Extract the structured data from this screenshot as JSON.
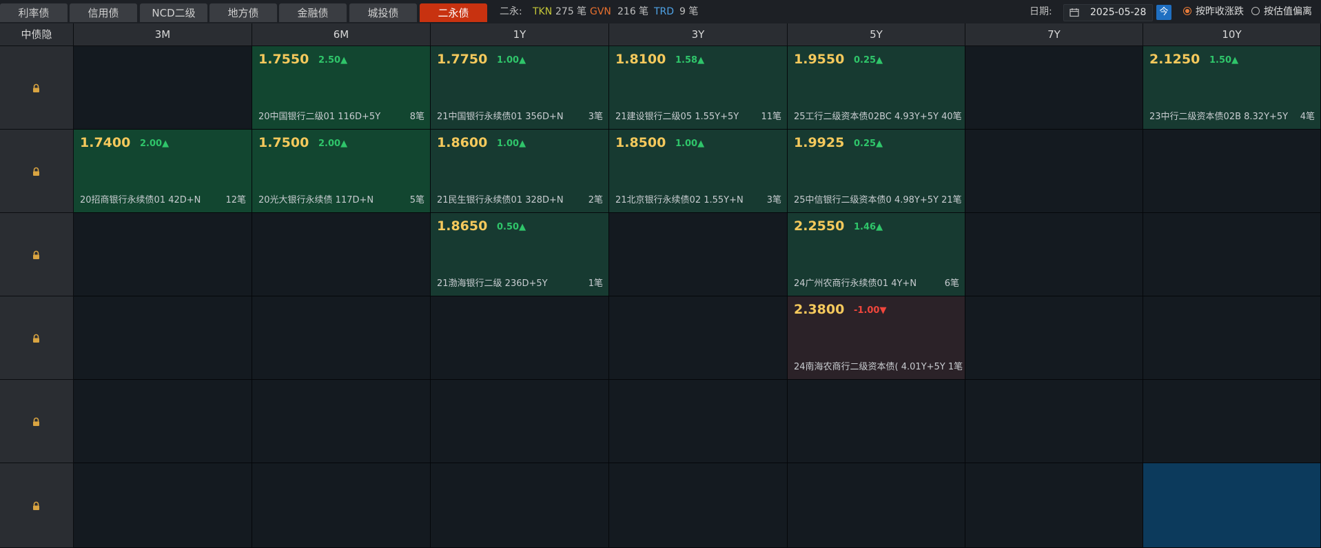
{
  "tabs": [
    {
      "label": "利率债",
      "active": false
    },
    {
      "label": "信用债",
      "active": false
    },
    {
      "label": "NCD二级",
      "active": false
    },
    {
      "label": "地方债",
      "active": false
    },
    {
      "label": "金融债",
      "active": false
    },
    {
      "label": "城投债",
      "active": false
    },
    {
      "label": "二永债",
      "active": true
    }
  ],
  "summary": {
    "prefix": "二永:",
    "tkn_label": "TKN",
    "tkn_value": "275 笔",
    "gvn_label": "GVN",
    "gvn_value": "216 笔",
    "trd_label": "TRD",
    "trd_value": "9 笔"
  },
  "date": {
    "label": "日期:",
    "value": "2025-05-28",
    "today": "今"
  },
  "sort_options": [
    {
      "label": "按昨收涨跌",
      "selected": true
    },
    {
      "label": "按估值偏离",
      "selected": false
    }
  ],
  "grid": {
    "corner_label": "中债隐",
    "columns": [
      "3M",
      "6M",
      "1Y",
      "3Y",
      "5Y",
      "7Y",
      "10Y"
    ],
    "row_count": 6,
    "cells": [
      {
        "row": 0,
        "col": 1,
        "yield": "1.7550",
        "change": "2.50▲",
        "dir": "up",
        "bond": "20中国银行二级01 116D+5Y",
        "count": "8笔",
        "tone": "green1"
      },
      {
        "row": 0,
        "col": 2,
        "yield": "1.7750",
        "change": "1.00▲",
        "dir": "up",
        "bond": "21中国银行永续债01 356D+N",
        "count": "3笔",
        "tone": "green2"
      },
      {
        "row": 0,
        "col": 3,
        "yield": "1.8100",
        "change": "1.58▲",
        "dir": "up",
        "bond": "21建设银行二级05 1.55Y+5Y",
        "count": "11笔",
        "tone": "green2"
      },
      {
        "row": 0,
        "col": 4,
        "yield": "1.9550",
        "change": "0.25▲",
        "dir": "up",
        "bond": "25工行二级资本债02BC 4.93Y+5Y 40笔",
        "count": "",
        "tone": "green2"
      },
      {
        "row": 0,
        "col": 6,
        "yield": "2.1250",
        "change": "1.50▲",
        "dir": "up",
        "bond": "23中行二级资本债02B 8.32Y+5Y",
        "count": "4笔",
        "tone": "green2"
      },
      {
        "row": 1,
        "col": 0,
        "yield": "1.7400",
        "change": "2.00▲",
        "dir": "up",
        "bond": "20招商银行永续债01 42D+N",
        "count": "12笔",
        "tone": "green1"
      },
      {
        "row": 1,
        "col": 1,
        "yield": "1.7500",
        "change": "2.00▲",
        "dir": "up",
        "bond": "20光大银行永续债 117D+N",
        "count": "5笔",
        "tone": "green1"
      },
      {
        "row": 1,
        "col": 2,
        "yield": "1.8600",
        "change": "1.00▲",
        "dir": "up",
        "bond": "21民生银行永续债01 328D+N",
        "count": "2笔",
        "tone": "green2"
      },
      {
        "row": 1,
        "col": 3,
        "yield": "1.8500",
        "change": "1.00▲",
        "dir": "up",
        "bond": "21北京银行永续债02 1.55Y+N",
        "count": "3笔",
        "tone": "green2"
      },
      {
        "row": 1,
        "col": 4,
        "yield": "1.9925",
        "change": "0.25▲",
        "dir": "up",
        "bond": "25中信银行二级资本债0 4.98Y+5Y 21笔",
        "count": "",
        "tone": "green2"
      },
      {
        "row": 2,
        "col": 2,
        "yield": "1.8650",
        "change": "0.50▲",
        "dir": "up",
        "bond": "21渤海银行二级 236D+5Y",
        "count": "1笔",
        "tone": "green2"
      },
      {
        "row": 2,
        "col": 4,
        "yield": "2.2550",
        "change": "1.46▲",
        "dir": "up",
        "bond": "24广州农商行永续债01 4Y+N",
        "count": "6笔",
        "tone": "green2"
      },
      {
        "row": 3,
        "col": 4,
        "yield": "2.3800",
        "change": "-1.00▼",
        "dir": "down",
        "bond": "24南海农商行二级资本债( 4.01Y+5Y 1笔",
        "count": "",
        "tone": "red"
      },
      {
        "row": 5,
        "col": 6,
        "yield": "",
        "change": "",
        "dir": "",
        "bond": "",
        "count": "",
        "tone": "blue"
      }
    ]
  },
  "colors": {
    "accent_tab": "#c83210",
    "yield": "#f5c95c",
    "up": "#2fc56a",
    "down": "#f0463c",
    "tkn": "#c5c838",
    "gvn": "#e8702e",
    "trd": "#4fa3e6"
  }
}
